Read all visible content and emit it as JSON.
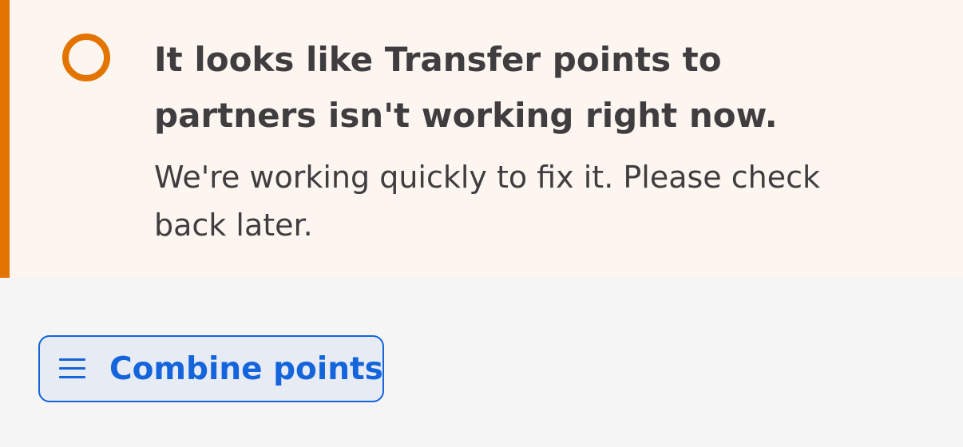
{
  "alert": {
    "title": "It looks like Transfer points to partners isn't working right now.",
    "message": "We're working quickly to fix it. Please check back later.",
    "status_icon": "empty-circle-icon",
    "accent_color": "#e37400",
    "background_color": "#fdf5f0"
  },
  "actions": {
    "combine_points_label": "Combine points",
    "combine_points_icon": "hamburger-menu-icon",
    "accent_color": "#1464dc"
  }
}
